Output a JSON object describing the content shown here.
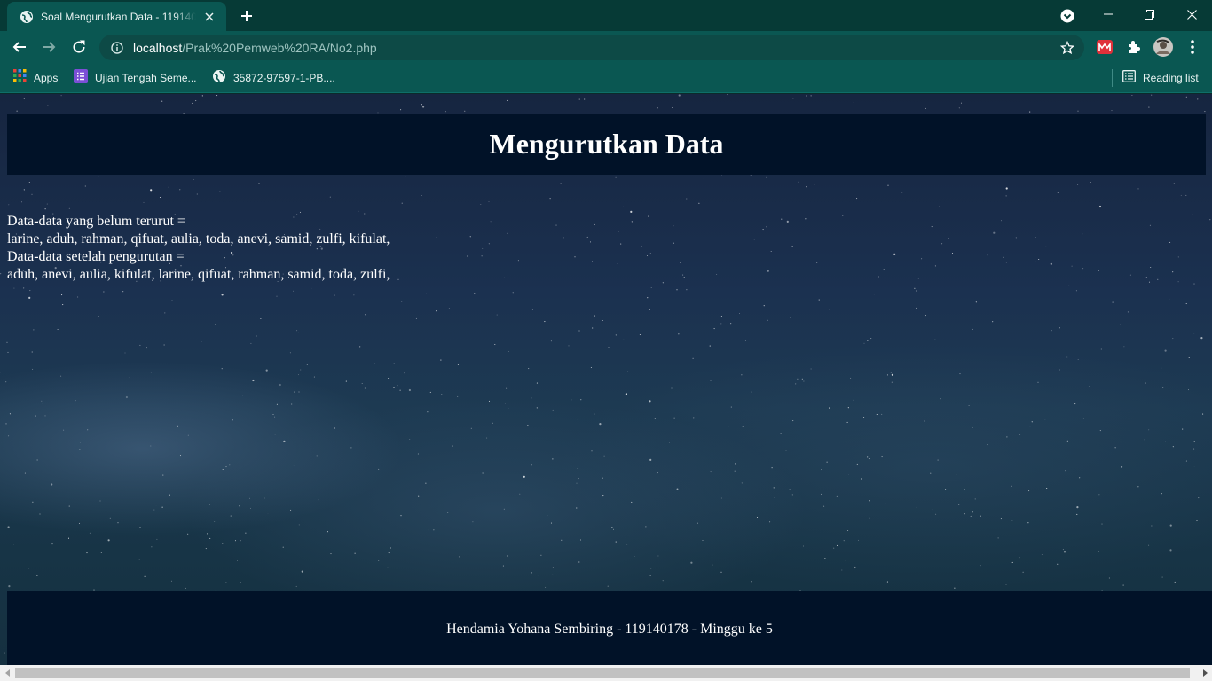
{
  "browser": {
    "tab_title": "Soal Mengurutkan Data - 119140178",
    "url_host": "localhost",
    "url_path": "/Prak%20Pemweb%20RA/No2.php",
    "bookmarks": [
      {
        "label": "Apps",
        "icon": "apps-grid-icon"
      },
      {
        "label": "Ujian Tengah Seme...",
        "icon": "form-list-icon"
      },
      {
        "label": "35872-97597-1-PB....",
        "icon": "globe-icon"
      }
    ],
    "reading_list_label": "Reading list",
    "colors": {
      "frame": "#063a36",
      "toolbar": "#0a5752",
      "omnibox": "#0d4a46"
    }
  },
  "page": {
    "header_title": "Mengurutkan Data",
    "lines": [
      "Data-data yang belum terurut =",
      "larine, aduh, rahman, qifuat, aulia, toda, anevi, samid, zulfi, kifulat,",
      "Data-data setelah pengurutan =",
      "aduh, anevi, aulia, kifulat, larine, qifuat, rahman, samid, toda, zulfi,"
    ],
    "footer_text": "Hendamia Yohana Sembiring - 119140178 - Minggu ke 5",
    "colors": {
      "panel": "#011228",
      "text": "#ffffff"
    }
  }
}
